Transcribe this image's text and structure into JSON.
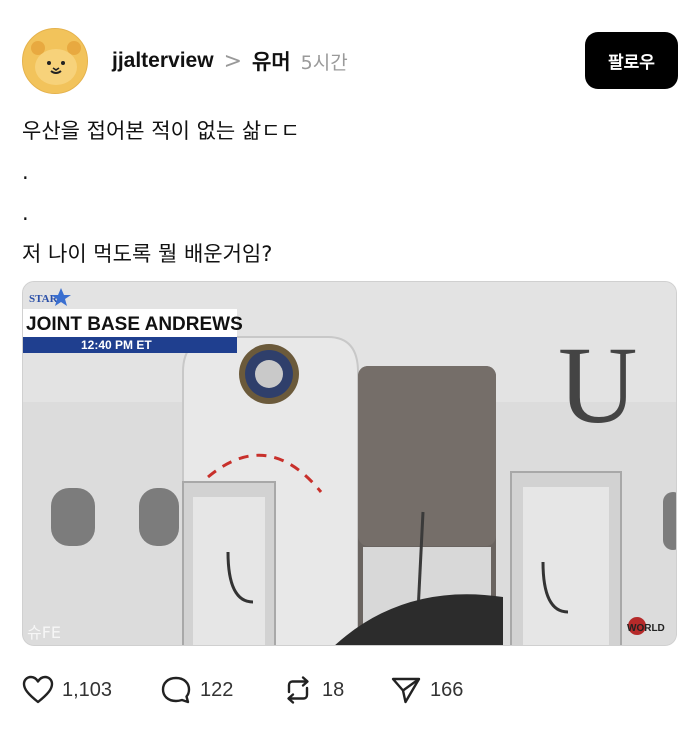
{
  "author": {
    "username": "jjalterview",
    "community": "유머",
    "time": "5시간",
    "avatar_icon": "hamster-avatar-icon"
  },
  "header": {
    "separator": ">",
    "follow_label": "팔로우"
  },
  "post": {
    "lines": [
      "우산을 접어본 적이 없는 삶ㄷㄷ",
      ".",
      ".",
      "저 나이 먹도록 뭘 배운거임?"
    ]
  },
  "media": {
    "network_logo": "STAR",
    "location_banner": "JOINT BASE ANDREWS",
    "time_banner": "12:40 PM ET",
    "fuselage_letter": "U",
    "watermark": "WORLD",
    "corner_mark": "슈FE"
  },
  "actions": {
    "likes": "1,103",
    "comments": "122",
    "reposts": "18",
    "shares": "166"
  },
  "colors": {
    "follow_bg": "#000000",
    "banner_blue": "#1f3f8f",
    "muted": "#9a9a9a"
  }
}
